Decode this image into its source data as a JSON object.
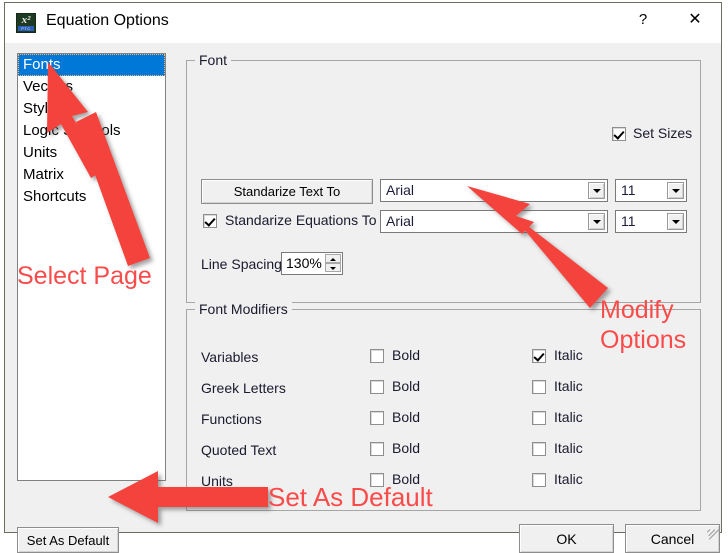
{
  "window": {
    "title": "Equation Options",
    "icon": "equation-app-icon",
    "icon_glyph": "x²",
    "icon_band": "PTC",
    "help_label": "?",
    "close_label": "✕",
    "bg_color": "#f0f0f0",
    "accent_color": "#0078d7"
  },
  "sidebar": {
    "name": "page-list",
    "items": [
      {
        "label": "Fonts",
        "selected": true
      },
      {
        "label": "Vectors",
        "selected": false
      },
      {
        "label": "Styles",
        "selected": false
      },
      {
        "label": "Logic Symbols",
        "selected": false
      },
      {
        "label": "Units",
        "selected": false
      },
      {
        "label": "Matrix",
        "selected": false
      },
      {
        "label": "Shortcuts",
        "selected": false
      }
    ]
  },
  "font_group": {
    "title": "Font",
    "set_sizes": {
      "label": "Set Sizes",
      "checked": true
    },
    "standarize_text": {
      "button_label": "Standarize Text To",
      "font_value": "Arial",
      "size_value": "11"
    },
    "standarize_equations": {
      "label": "Standarize Equations To",
      "checked": true,
      "font_value": "Arial",
      "size_value": "11"
    },
    "line_spacing": {
      "label": "Line Spacing",
      "value": "130%"
    }
  },
  "modifiers_group": {
    "title": "Font Modifiers",
    "bold_label": "Bold",
    "italic_label": "Italic",
    "rows": [
      {
        "label": "Variables",
        "bold": false,
        "italic": true
      },
      {
        "label": "Greek Letters",
        "bold": false,
        "italic": false
      },
      {
        "label": "Functions",
        "bold": false,
        "italic": false
      },
      {
        "label": "Quoted Text",
        "bold": false,
        "italic": false
      },
      {
        "label": "Units",
        "bold": false,
        "italic": false
      }
    ]
  },
  "footer": {
    "set_as_default": "Set As Default",
    "ok": "OK",
    "cancel": "Cancel"
  },
  "annotations": {
    "color": "#fa4b4b",
    "select_page": "Select Page",
    "modify_line1": "Modify",
    "modify_line2": "Options",
    "set_as_default": "Set As Default"
  }
}
